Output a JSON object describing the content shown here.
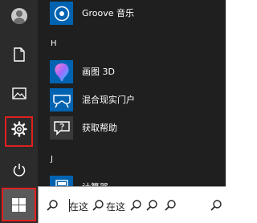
{
  "start_menu": {
    "rail": {
      "account_icon": "user-avatar-icon",
      "documents_icon": "document-icon",
      "pictures_icon": "picture-icon",
      "settings_icon": "gear-icon",
      "power_icon": "power-icon",
      "start_icon": "windows-logo-icon"
    },
    "apps": [
      {
        "label": "Groove 音乐",
        "icon": "groove-music-icon",
        "tile_color": "#0063b1"
      },
      {
        "letter": "H"
      },
      {
        "label": "画图 3D",
        "icon": "paint-3d-icon",
        "tile_color": "#0063b1"
      },
      {
        "label": "混合现实门户",
        "icon": "mixed-reality-icon",
        "tile_color": "#0063b1"
      },
      {
        "label": "获取帮助",
        "icon": "get-help-icon",
        "tile_color": "#3a3a3a"
      },
      {
        "letter": "J"
      },
      {
        "label": "计算器",
        "icon": "calculator-icon",
        "tile_color": "#0063b1"
      }
    ],
    "search": {
      "fragment_1": "在这",
      "fragment_2": "在这"
    },
    "highlight_color": "#e02020"
  }
}
